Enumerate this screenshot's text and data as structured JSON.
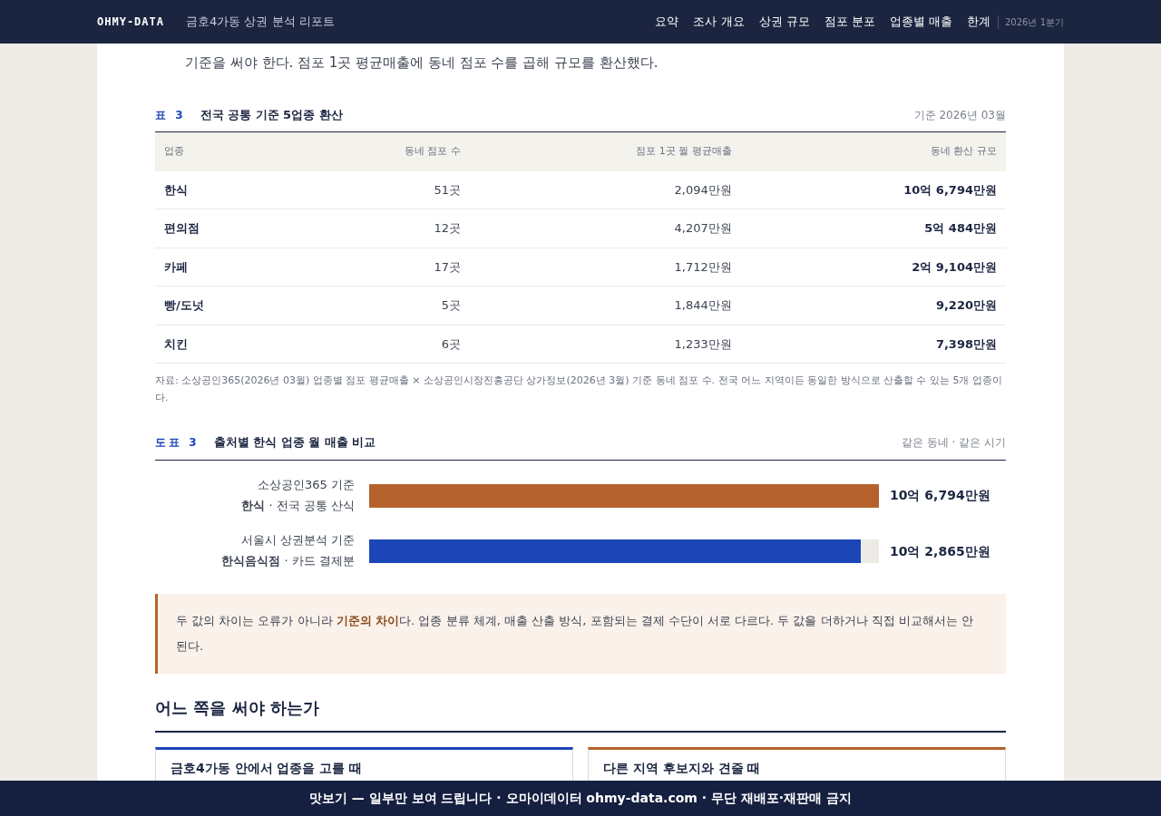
{
  "header": {
    "logo": "OHMY-DATA",
    "title": "금호4가동 상권 분석 리포트",
    "nav": [
      {
        "label": "요약",
        "selected": false
      },
      {
        "label": "조사 개요",
        "selected": false
      },
      {
        "label": "상권 규모",
        "selected": false
      },
      {
        "label": "점포 분포",
        "selected": false
      },
      {
        "label": "업종별 매출",
        "selected": false
      },
      {
        "label": "한계",
        "selected": false
      }
    ],
    "period": "2026년 1분기"
  },
  "intro": "기준을 써야 한다. 점포 1곳 평균매출에 동네 점포 수를 곱해 규모를 환산했다.",
  "table": {
    "tag": "표 3",
    "title": "전국 공통 기준 5업종 환산",
    "note": "기준 2026년 03월",
    "columns": [
      "업종",
      "동네 점포 수",
      "점포 1곳 월 평균매출",
      "동네 환산 규모"
    ],
    "rows": [
      [
        "한식",
        "51곳",
        "2,094만원",
        "10억 6,794만원"
      ],
      [
        "편의점",
        "12곳",
        "4,207만원",
        "5억 484만원"
      ],
      [
        "카페",
        "17곳",
        "1,712만원",
        "2억 9,104만원"
      ],
      [
        "빵/도넛",
        "5곳",
        "1,844만원",
        "9,220만원"
      ],
      [
        "치킨",
        "6곳",
        "1,233만원",
        "7,398만원"
      ]
    ],
    "source": "자료: 소상공인365(2026년 03월) 업종별 점포 평균매출 × 소상공인시장진흥공단 상가정보(2026년 3월) 기준 동네 점포 수. 전국 어느 지역이든 동일한 방식으로 산출할 수 있는 5개 업종이다."
  },
  "figure": {
    "tag": "도표 3",
    "title": "출처별 한식 업종 월 매출 비교",
    "note": "같은 동네 · 같은 시기",
    "bars": [
      {
        "source": "소상공인365 기준",
        "desc": "**한식** · 전국 공통 산식",
        "level": 1.0,
        "color": "#b5612d",
        "value": "10억 6,794만원"
      },
      {
        "source": "서울시 상권분석 기준",
        "desc": "**한식음식점** · 카드 결제분",
        "level": 0.964,
        "color": "#1c45b8",
        "value": "10억 2,865만원"
      }
    ]
  },
  "callout": "두 값의 차이는 오류가 아니라 **기준의 차이**다. 업종 분류 체계, 매출 산출 방식, 포함되는 결제 수단이 서로 다르다. 두 값을 더하거나 직접 비교해서는 안 된다.",
  "section": {
    "title": "어느 쪽을 써야 하는가",
    "cards": [
      {
        "title": "금호4가동 안에서 업종을 고를 때",
        "color": "#1c45b8"
      },
      {
        "title": "다른 지역 후보지와 견줄 때",
        "color": "#b5612d"
      }
    ]
  },
  "banner": "맛보기 — 일부만 보여 드립니다 · 오마이데이터 ohmy-data.com · 무단 재배포·재판매 금지"
}
